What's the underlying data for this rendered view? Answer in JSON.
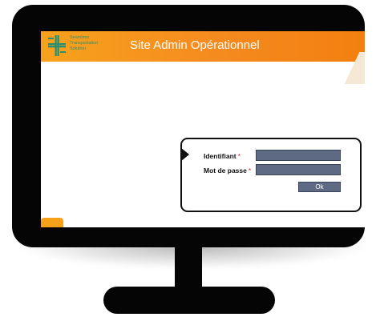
{
  "header": {
    "logo_lines": [
      "Seamless",
      "Transportation",
      "Solution"
    ],
    "title": "Site Admin Opérationnel"
  },
  "login": {
    "username_label": "Identifiant",
    "password_label": "Mot de passe",
    "required_marker": "*",
    "submit_label": "Ok"
  },
  "colors": {
    "header_accent": "#f58a1f",
    "logo_green": "#2a8f70",
    "field_fill": "#5e6a84",
    "required_red": "#d7262b"
  }
}
